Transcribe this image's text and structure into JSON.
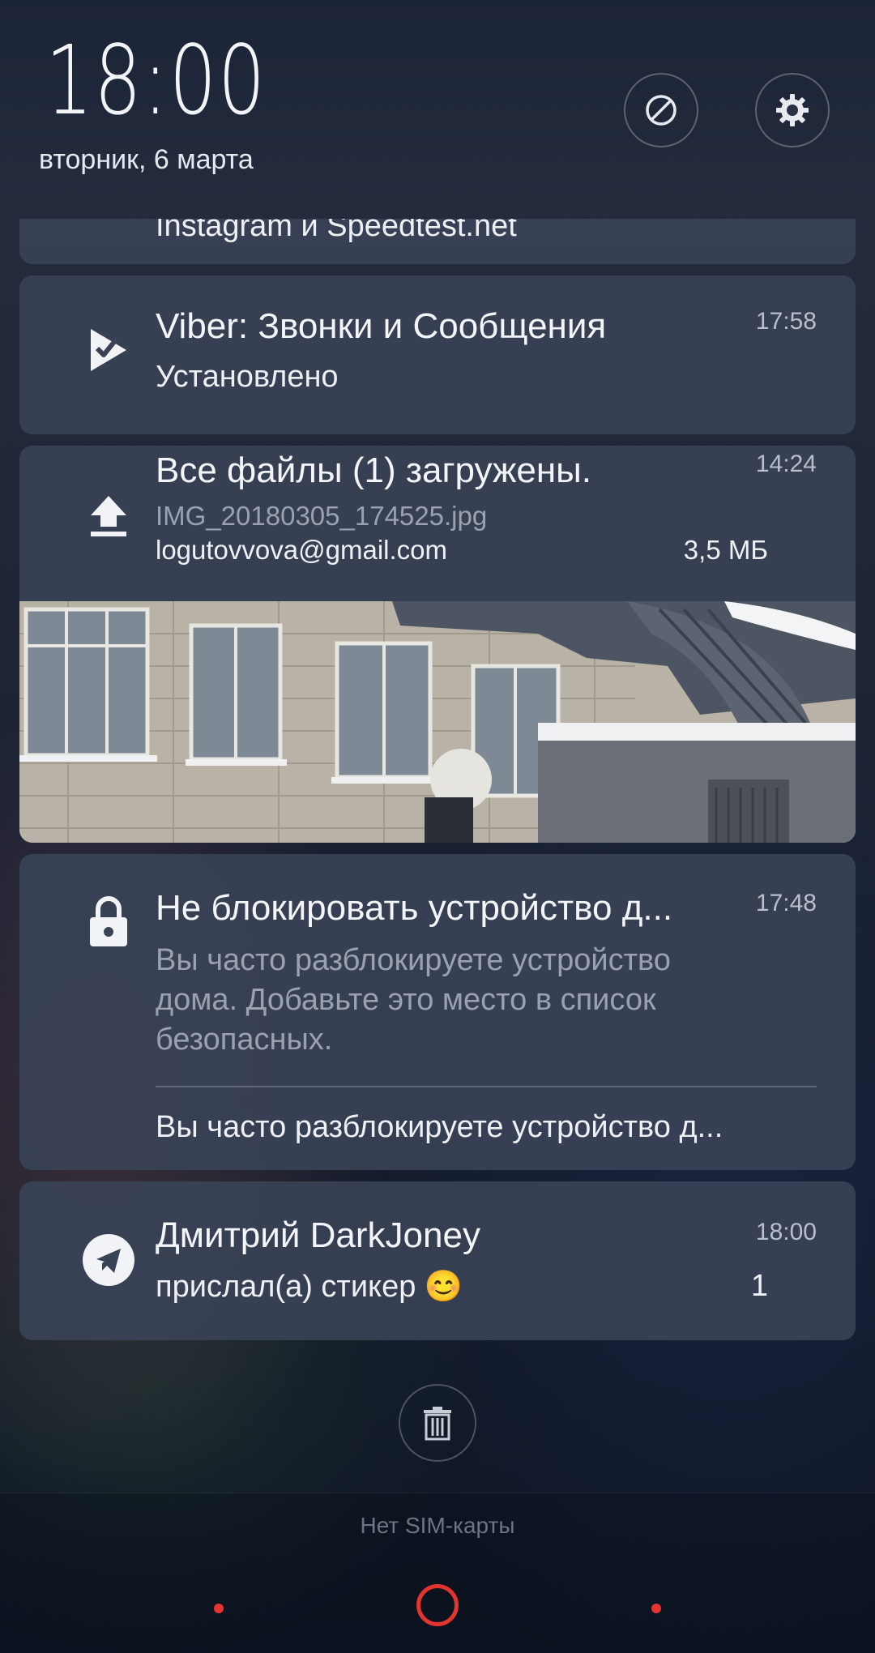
{
  "header": {
    "time": "18:00",
    "date": "вторник, 6 марта"
  },
  "notifications": {
    "partial": {
      "text": "Instagram и Speedtest.net"
    },
    "viber": {
      "title": "Viber: Звонки и Сообщения",
      "status": "Установлено",
      "time": "17:58"
    },
    "upload": {
      "title": "Все файлы (1) загружены.",
      "filename": "IMG_20180305_174525.jpg",
      "account": "logutovvova@gmail.com",
      "size": "3,5 МБ",
      "time": "14:24"
    },
    "lock": {
      "title": "Не блокировать устройство д...",
      "time": "17:48",
      "body_line1": "Вы часто разблокируете устройство",
      "body_line2": "дома. Добавьте это место в список",
      "body_line3": "безопасных.",
      "action": "Вы часто разблокируете устройство д..."
    },
    "telegram": {
      "title": "Дмитрий DarkJoney",
      "message": "прислал(а) стикер 😊",
      "time": "18:00",
      "count": "1"
    }
  },
  "footer": {
    "sim_status": "Нет SIM-карты"
  },
  "colors": {
    "card_bg": "#3a4256",
    "nav_accent": "#e3342f"
  },
  "icons": [
    "dnd-icon",
    "settings-gear-icon",
    "install-done-icon",
    "upload-icon",
    "lock-icon",
    "telegram-icon",
    "trash-icon"
  ]
}
